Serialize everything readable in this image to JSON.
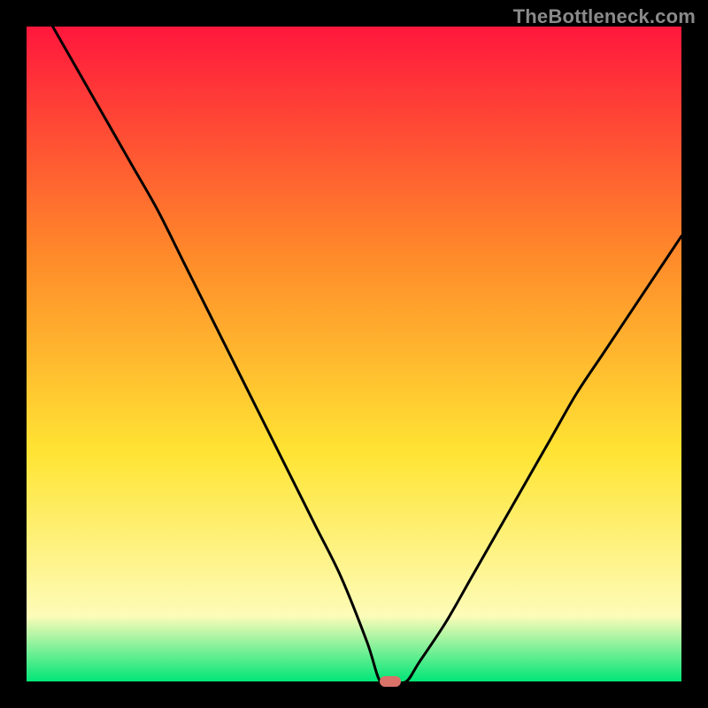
{
  "watermark": "TheBottleneck.com",
  "colors": {
    "frame": "#000000",
    "watermark_text": "#8a8a8a",
    "curve": "#000000",
    "marker": "#d9736a",
    "gradient_top": "#ff173d",
    "gradient_mid_upper": "#ff8a2a",
    "gradient_mid": "#ffe433",
    "gradient_mid_lower": "#fdfcb8",
    "gradient_bottom": "#00e577"
  },
  "chart_data": {
    "type": "line",
    "title": "",
    "xlabel": "",
    "ylabel": "",
    "xlim": [
      0,
      100
    ],
    "ylim": [
      0,
      100
    ],
    "grid": false,
    "legend": null,
    "marker": {
      "x": 55.5,
      "y": 0,
      "w": 3.2,
      "h": 1.6
    },
    "series": [
      {
        "name": "curve",
        "x": [
          4,
          8,
          12,
          16,
          20,
          24,
          28,
          32,
          36,
          40,
          44,
          48,
          52,
          54,
          56,
          58,
          60,
          64,
          68,
          72,
          76,
          80,
          84,
          88,
          92,
          96,
          100
        ],
        "y": [
          100,
          93,
          86,
          79,
          72,
          64,
          56,
          48,
          40,
          32,
          24,
          16,
          6,
          0,
          0,
          0,
          3,
          9,
          16,
          23,
          30,
          37,
          44,
          50,
          56,
          62,
          68
        ]
      }
    ]
  }
}
